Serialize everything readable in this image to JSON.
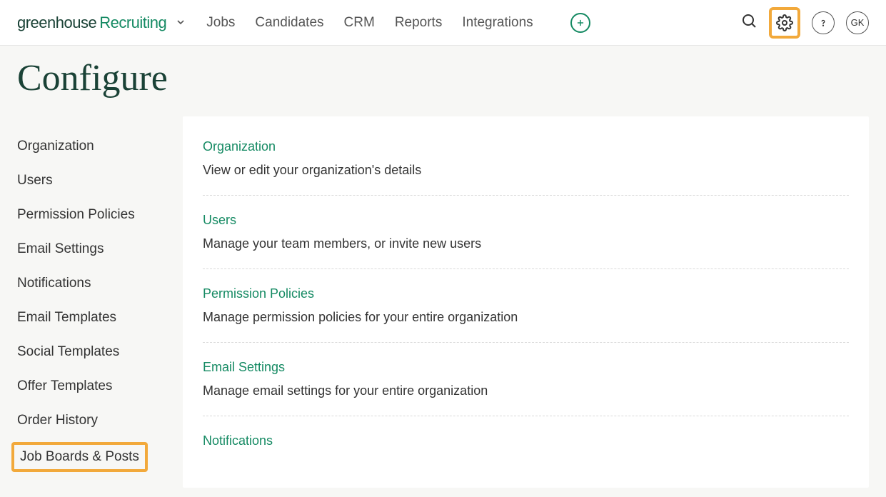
{
  "brand": {
    "word1": "greenhouse",
    "word2": "Recruiting"
  },
  "nav": [
    "Jobs",
    "Candidates",
    "CRM",
    "Reports",
    "Integrations"
  ],
  "avatar": "GK",
  "page_title": "Configure",
  "sidebar": {
    "items": [
      "Organization",
      "Users",
      "Permission Policies",
      "Email Settings",
      "Notifications",
      "Email Templates",
      "Social Templates",
      "Offer Templates",
      "Order History",
      "Job Boards & Posts"
    ]
  },
  "panel": [
    {
      "title": "Organization",
      "desc": "View or edit your organization's details"
    },
    {
      "title": "Users",
      "desc": "Manage your team members, or invite new users"
    },
    {
      "title": "Permission Policies",
      "desc": "Manage permission policies for your entire organization"
    },
    {
      "title": "Email Settings",
      "desc": "Manage email settings for your entire organization"
    },
    {
      "title": "Notifications",
      "desc": ""
    }
  ]
}
